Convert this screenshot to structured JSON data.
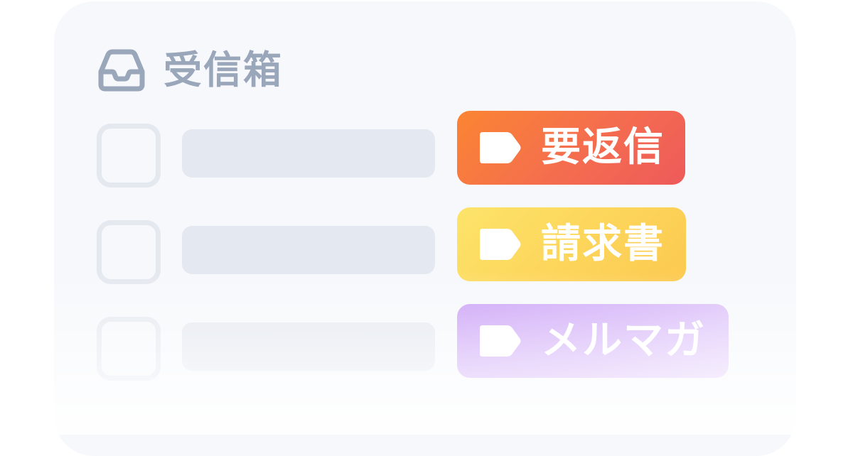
{
  "inbox": {
    "icon": "inbox-tray-icon",
    "title": "受信箱"
  },
  "messages": [
    {
      "label": {
        "icon": "tag-icon",
        "text": "要返信",
        "colors": [
          "#fb8533",
          "#ee5a5a"
        ]
      }
    },
    {
      "label": {
        "icon": "tag-icon",
        "text": "請求書",
        "colors": [
          "#fde36a",
          "#fcc94f"
        ]
      }
    },
    {
      "label": {
        "icon": "tag-icon",
        "text": "メルマガ",
        "colors": [
          "#c99ef6",
          "#e2cdfb"
        ]
      }
    }
  ],
  "colors": {
    "card_background": "#f6f8fb",
    "placeholder": "#e4e8f0",
    "title": "#9aa6b9"
  }
}
